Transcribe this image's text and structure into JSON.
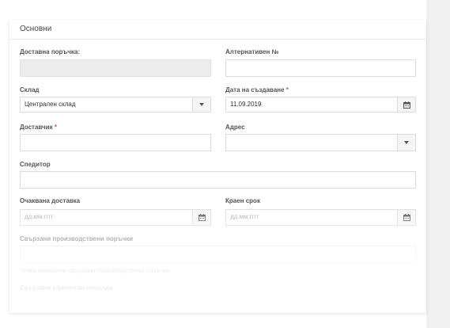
{
  "section": {
    "title": "Основни"
  },
  "form": {
    "delivery_order": {
      "label": "Доставна поръчка:",
      "value": ""
    },
    "alt_number": {
      "label": "Алтернативен №",
      "value": ""
    },
    "warehouse": {
      "label": "Склад",
      "value": "Централен склад"
    },
    "created_date": {
      "label": "Дата на създаване",
      "required_mark": "*",
      "value": "11.09.2019"
    },
    "supplier": {
      "label": "Доставчик",
      "required_mark": "*",
      "value": ""
    },
    "address": {
      "label": "Адрес",
      "value": ""
    },
    "forwarder": {
      "label": "Спедитор",
      "value": ""
    },
    "expected_delivery": {
      "label": "Очаквана доставка",
      "placeholder": "дд.мм.гггг"
    },
    "deadline": {
      "label": "Краен срок",
      "placeholder": "дд.мм.гггг"
    },
    "related_production_orders": {
      "label": "Свързани производствени поръчки",
      "empty_message": "Няма намерени свързани производствени поръчки"
    },
    "related_client_orders": {
      "label": "Свързани клиентски поръчки"
    }
  },
  "icons": {
    "dropdown": "chevron-down-icon",
    "calendar": "calendar-icon"
  },
  "colors": {
    "required": "#d9534f",
    "disabled_field": "#ececec",
    "side_panel": "#f1f1f2"
  }
}
